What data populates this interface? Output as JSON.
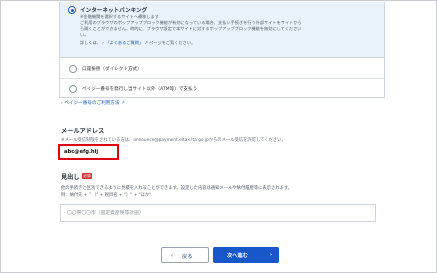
{
  "payment_methods": {
    "netbanking": {
      "label": "インターネットバンキング",
      "note1": "※金融機関を選択するサイトへ遷移します",
      "note2": "ご利用のブラウザのポップアップブロック機能が有効になっている場合、支払い手続きを行う外部サイトをサイトから",
      "note3": "ら開くことができません。時的に、ブラウザ設定で本サイトに対するポップアップブロック機能を無効にしてください",
      "note4": "い。",
      "faq_prefix": "詳しくは、",
      "faq_link": "「よくあるご質問」",
      "faq_suffix": "ページをご覧ください。"
    },
    "account_transfer": {
      "label": "口座振替（ダイレクト方式）"
    },
    "payeasy": {
      "label": "ペイジー番号を発行し当サイト以外（ATM等）で支払う"
    }
  },
  "payee_link": "ペイジー番号のご利用方法",
  "email": {
    "title": "メールアドレス",
    "note": "※メール受信制限をされている方は、announce@payment.eltax.lta.go.jpからのメール受信を許可してください。",
    "value": "abc@efg.hij"
  },
  "heading": {
    "title": "見出し",
    "required_badge": "必須",
    "note1": "他の手続きと区別できるように見積を入れることができます。設定した内容は通知メールや納付履歴等に表示されます。",
    "note2": "例：納付先 + \" （\" + 税目名 + \"）\" + \"ほか\"",
    "placeholder": "〇〇県〇〇市（固定資産税等計画）"
  },
  "buttons": {
    "back": "戻る",
    "next": "次へ進む"
  }
}
